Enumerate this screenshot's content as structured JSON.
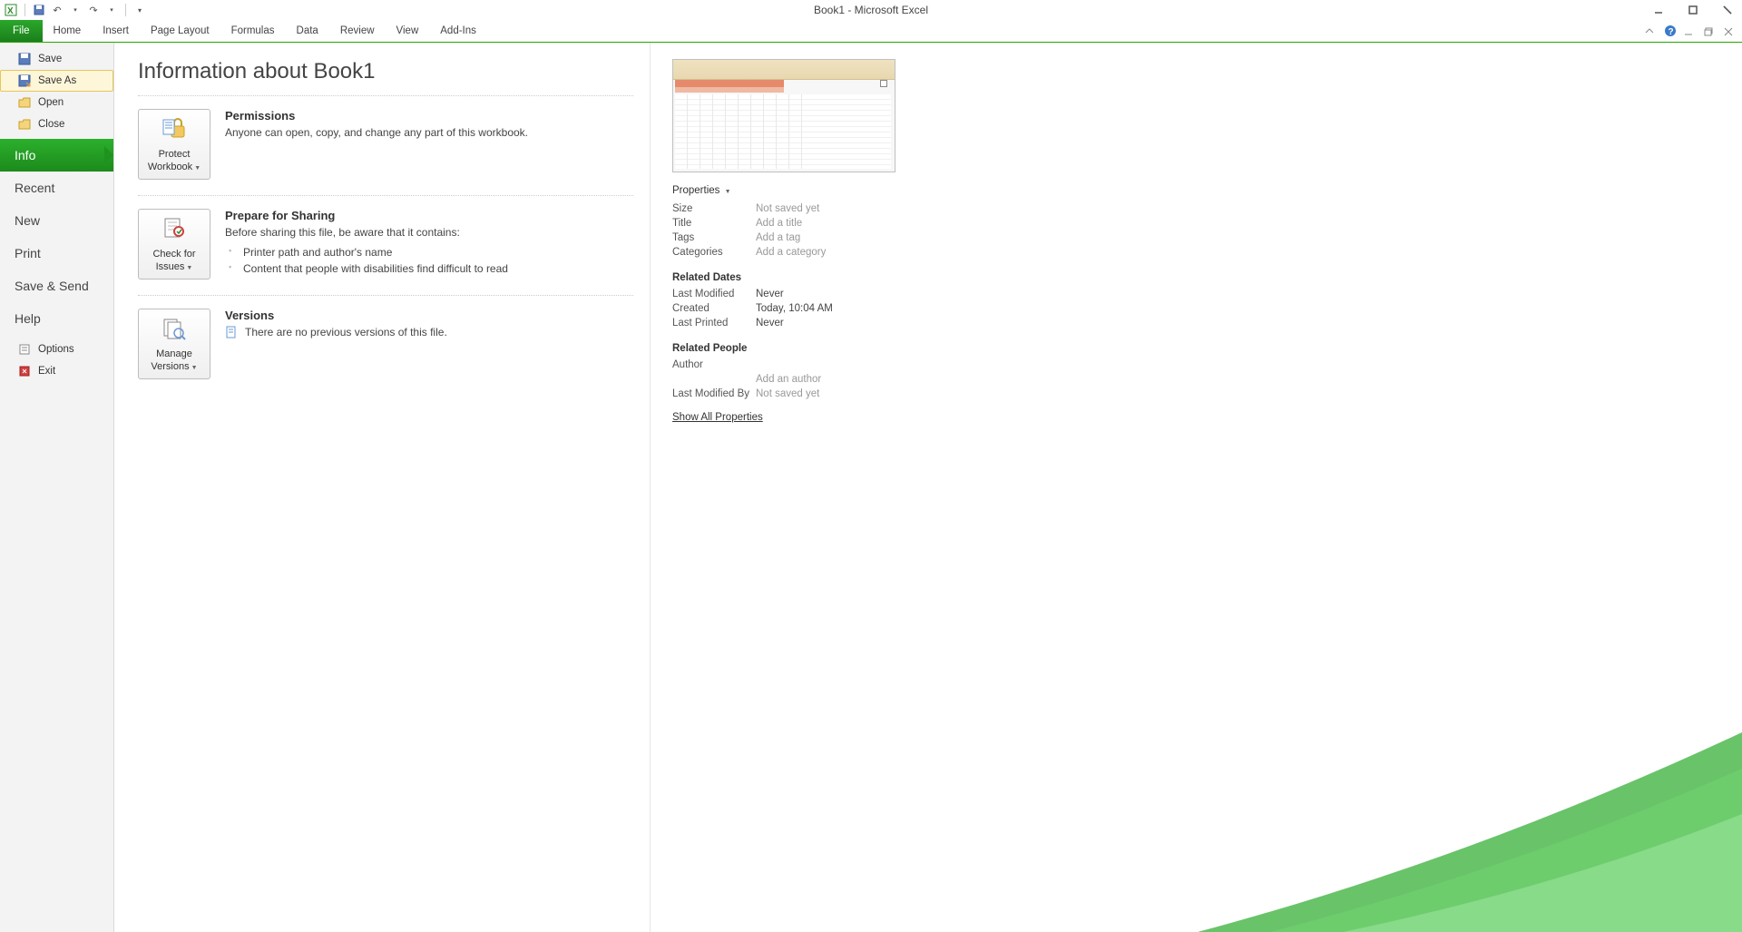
{
  "title": "Book1 - Microsoft Excel",
  "ribbon": {
    "tabs": [
      "File",
      "Home",
      "Insert",
      "Page Layout",
      "Formulas",
      "Data",
      "Review",
      "View",
      "Add-Ins"
    ]
  },
  "sidebar": {
    "items": [
      {
        "label": "Save",
        "icon": "save"
      },
      {
        "label": "Save As",
        "icon": "save-as"
      },
      {
        "label": "Open",
        "icon": "folder-open"
      },
      {
        "label": "Close",
        "icon": "folder-close"
      }
    ],
    "selected": "Info",
    "big_items": [
      "Recent",
      "New",
      "Print",
      "Save & Send",
      "Help"
    ],
    "bottom": [
      {
        "label": "Options",
        "icon": "options"
      },
      {
        "label": "Exit",
        "icon": "exit"
      }
    ]
  },
  "page": {
    "title": "Information about Book1",
    "permissions": {
      "heading": "Permissions",
      "text": "Anyone can open, copy, and change any part of this workbook.",
      "button_l1": "Protect",
      "button_l2": "Workbook"
    },
    "sharing": {
      "heading": "Prepare for Sharing",
      "text": "Before sharing this file, be aware that it contains:",
      "bullets": [
        "Printer path and author's name",
        "Content that people with disabilities find difficult to read"
      ],
      "button_l1": "Check for",
      "button_l2": "Issues"
    },
    "versions": {
      "heading": "Versions",
      "text": "There are no previous versions of this file.",
      "button_l1": "Manage",
      "button_l2": "Versions"
    }
  },
  "properties": {
    "header": "Properties",
    "rows": [
      {
        "label": "Size",
        "value": "Not saved yet",
        "muted": true
      },
      {
        "label": "Title",
        "value": "Add a title",
        "muted": true
      },
      {
        "label": "Tags",
        "value": "Add a tag",
        "muted": true
      },
      {
        "label": "Categories",
        "value": "Add a category",
        "muted": true
      }
    ],
    "dates_header": "Related Dates",
    "dates": [
      {
        "label": "Last Modified",
        "value": "Never"
      },
      {
        "label": "Created",
        "value": "Today, 10:04 AM"
      },
      {
        "label": "Last Printed",
        "value": "Never"
      }
    ],
    "people_header": "Related People",
    "author_label": "Author",
    "add_author": "Add an author",
    "modified_by_label": "Last Modified By",
    "modified_by_value": "Not saved yet",
    "show_all": "Show All Properties"
  }
}
